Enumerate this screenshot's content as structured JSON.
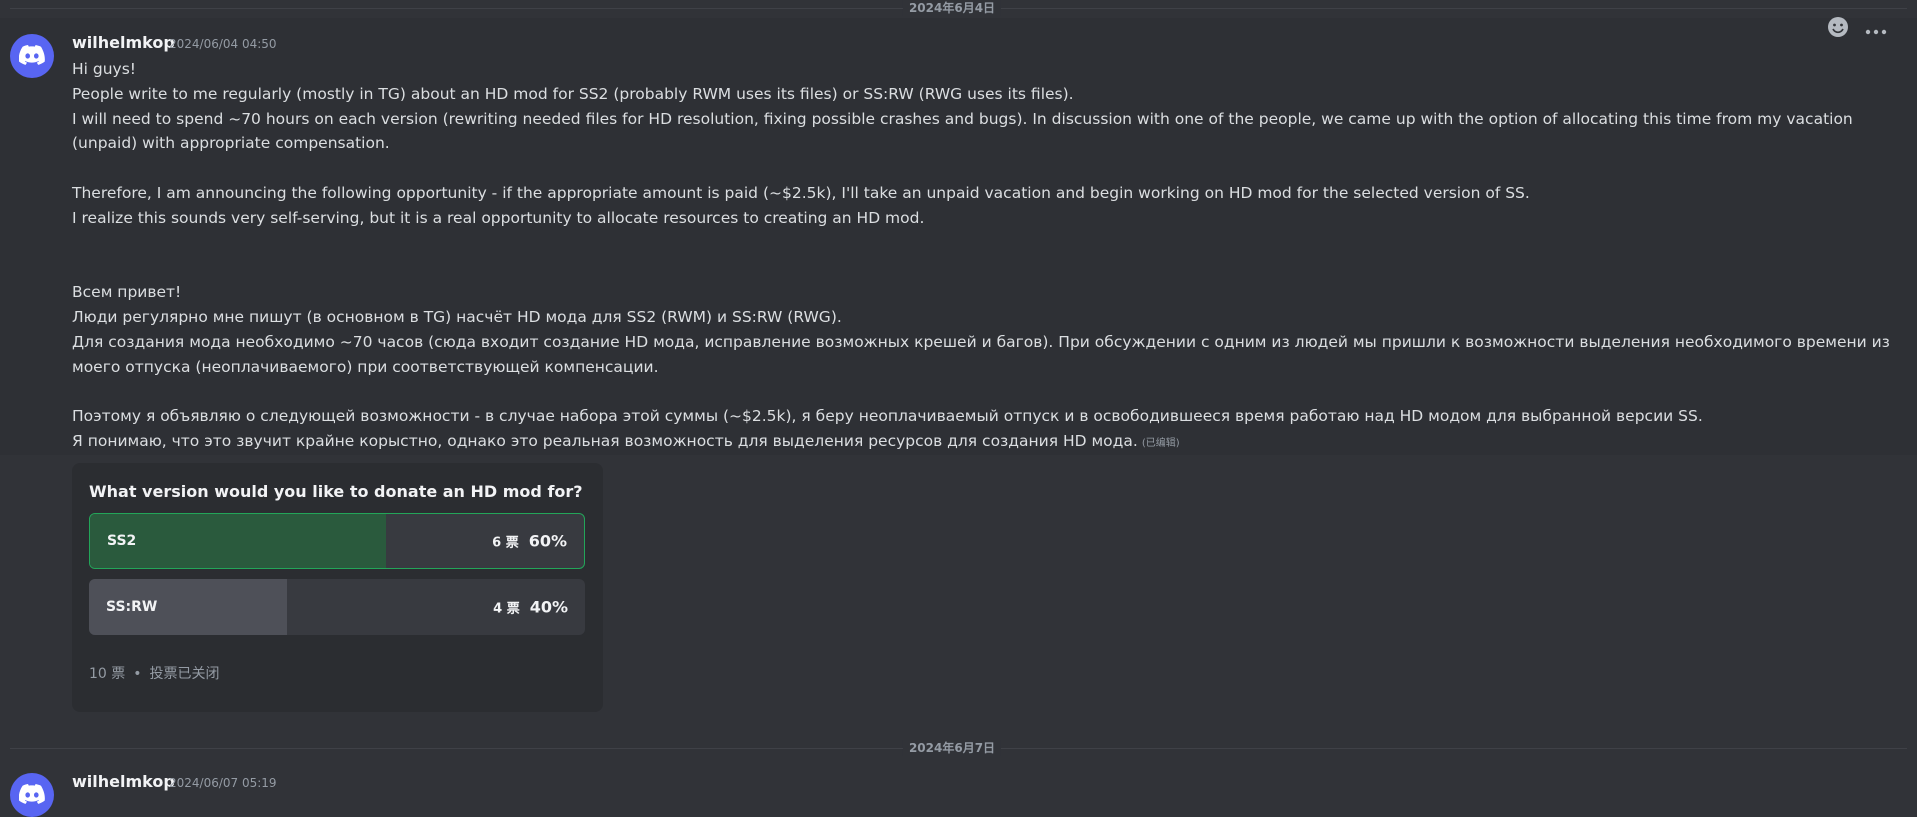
{
  "date_dividers": [
    "2024年6月4日",
    "2024年6月7日"
  ],
  "messages": [
    {
      "username": "wilhelmkop",
      "timestamp": "2024/06/04 04:50",
      "lines": [
        "Hi guys!",
        "People write to me regularly (mostly in TG) about an HD mod for SS2 (probably RWM uses its files) or SS:RW (RWG uses its files).",
        "I will need to spend ~70 hours on each version (rewriting needed files for HD resolution, fixing possible crashes and bugs). In discussion with one of the people, we came up with the option of allocating this time from my vacation (unpaid) with appropriate compensation.",
        "",
        "Therefore, I am announcing the following opportunity - if the appropriate amount is paid (~$2.5k), I'll take an unpaid vacation and begin working on HD mod for the selected version of SS.",
        "I realize this sounds very self-serving, but it is a real opportunity to allocate resources to creating an HD mod.",
        "",
        "",
        "Всем привет!",
        "Люди регулярно мне пишут (в основном в TG) насчёт HD мода для SS2 (RWM) и SS:RW (RWG).",
        "Для создания мода необходимо ~70 часов (сюда входит создание HD мода, исправление возможных крешей и багов). При обсуждении с одним из людей мы пришли к возможности выделения необходимого времени из моего отпуска (неоплачиваемого) при соответствующей компенсации.",
        "",
        "Поэтому я объявляю о следующей возможности - в случае набора этой суммы (~$2.5k), я беру неоплачиваемый отпуск и в освободившееся время работаю над HD модом для выбранной версии SS.",
        "Я понимаю, что это звучит крайне корыстно, однако это реальная возможность для выделения ресурсов для создания HD мода."
      ],
      "edited_label": "(已编辑)"
    },
    {
      "username": "wilhelmkop",
      "timestamp": "2024/06/07 05:19"
    }
  ],
  "poll": {
    "question": "What version would you like to donate an HD mod for?",
    "answers": [
      {
        "label": "SS2",
        "votes": "6 票",
        "percent": "60%",
        "fraction": 0.6
      },
      {
        "label": "SS:RW",
        "votes": "4 票",
        "percent": "40%",
        "fraction": 0.4
      }
    ],
    "total_votes": "10 票",
    "status": "投票已关闭"
  },
  "icons": {
    "avatar": "discord-logo-icon",
    "add_reaction": "add-reaction-icon",
    "more": "more-options-icon"
  },
  "colors": {
    "background": "#313338",
    "blurple": "#5865f2",
    "poll_winner_border": "#23a559"
  }
}
